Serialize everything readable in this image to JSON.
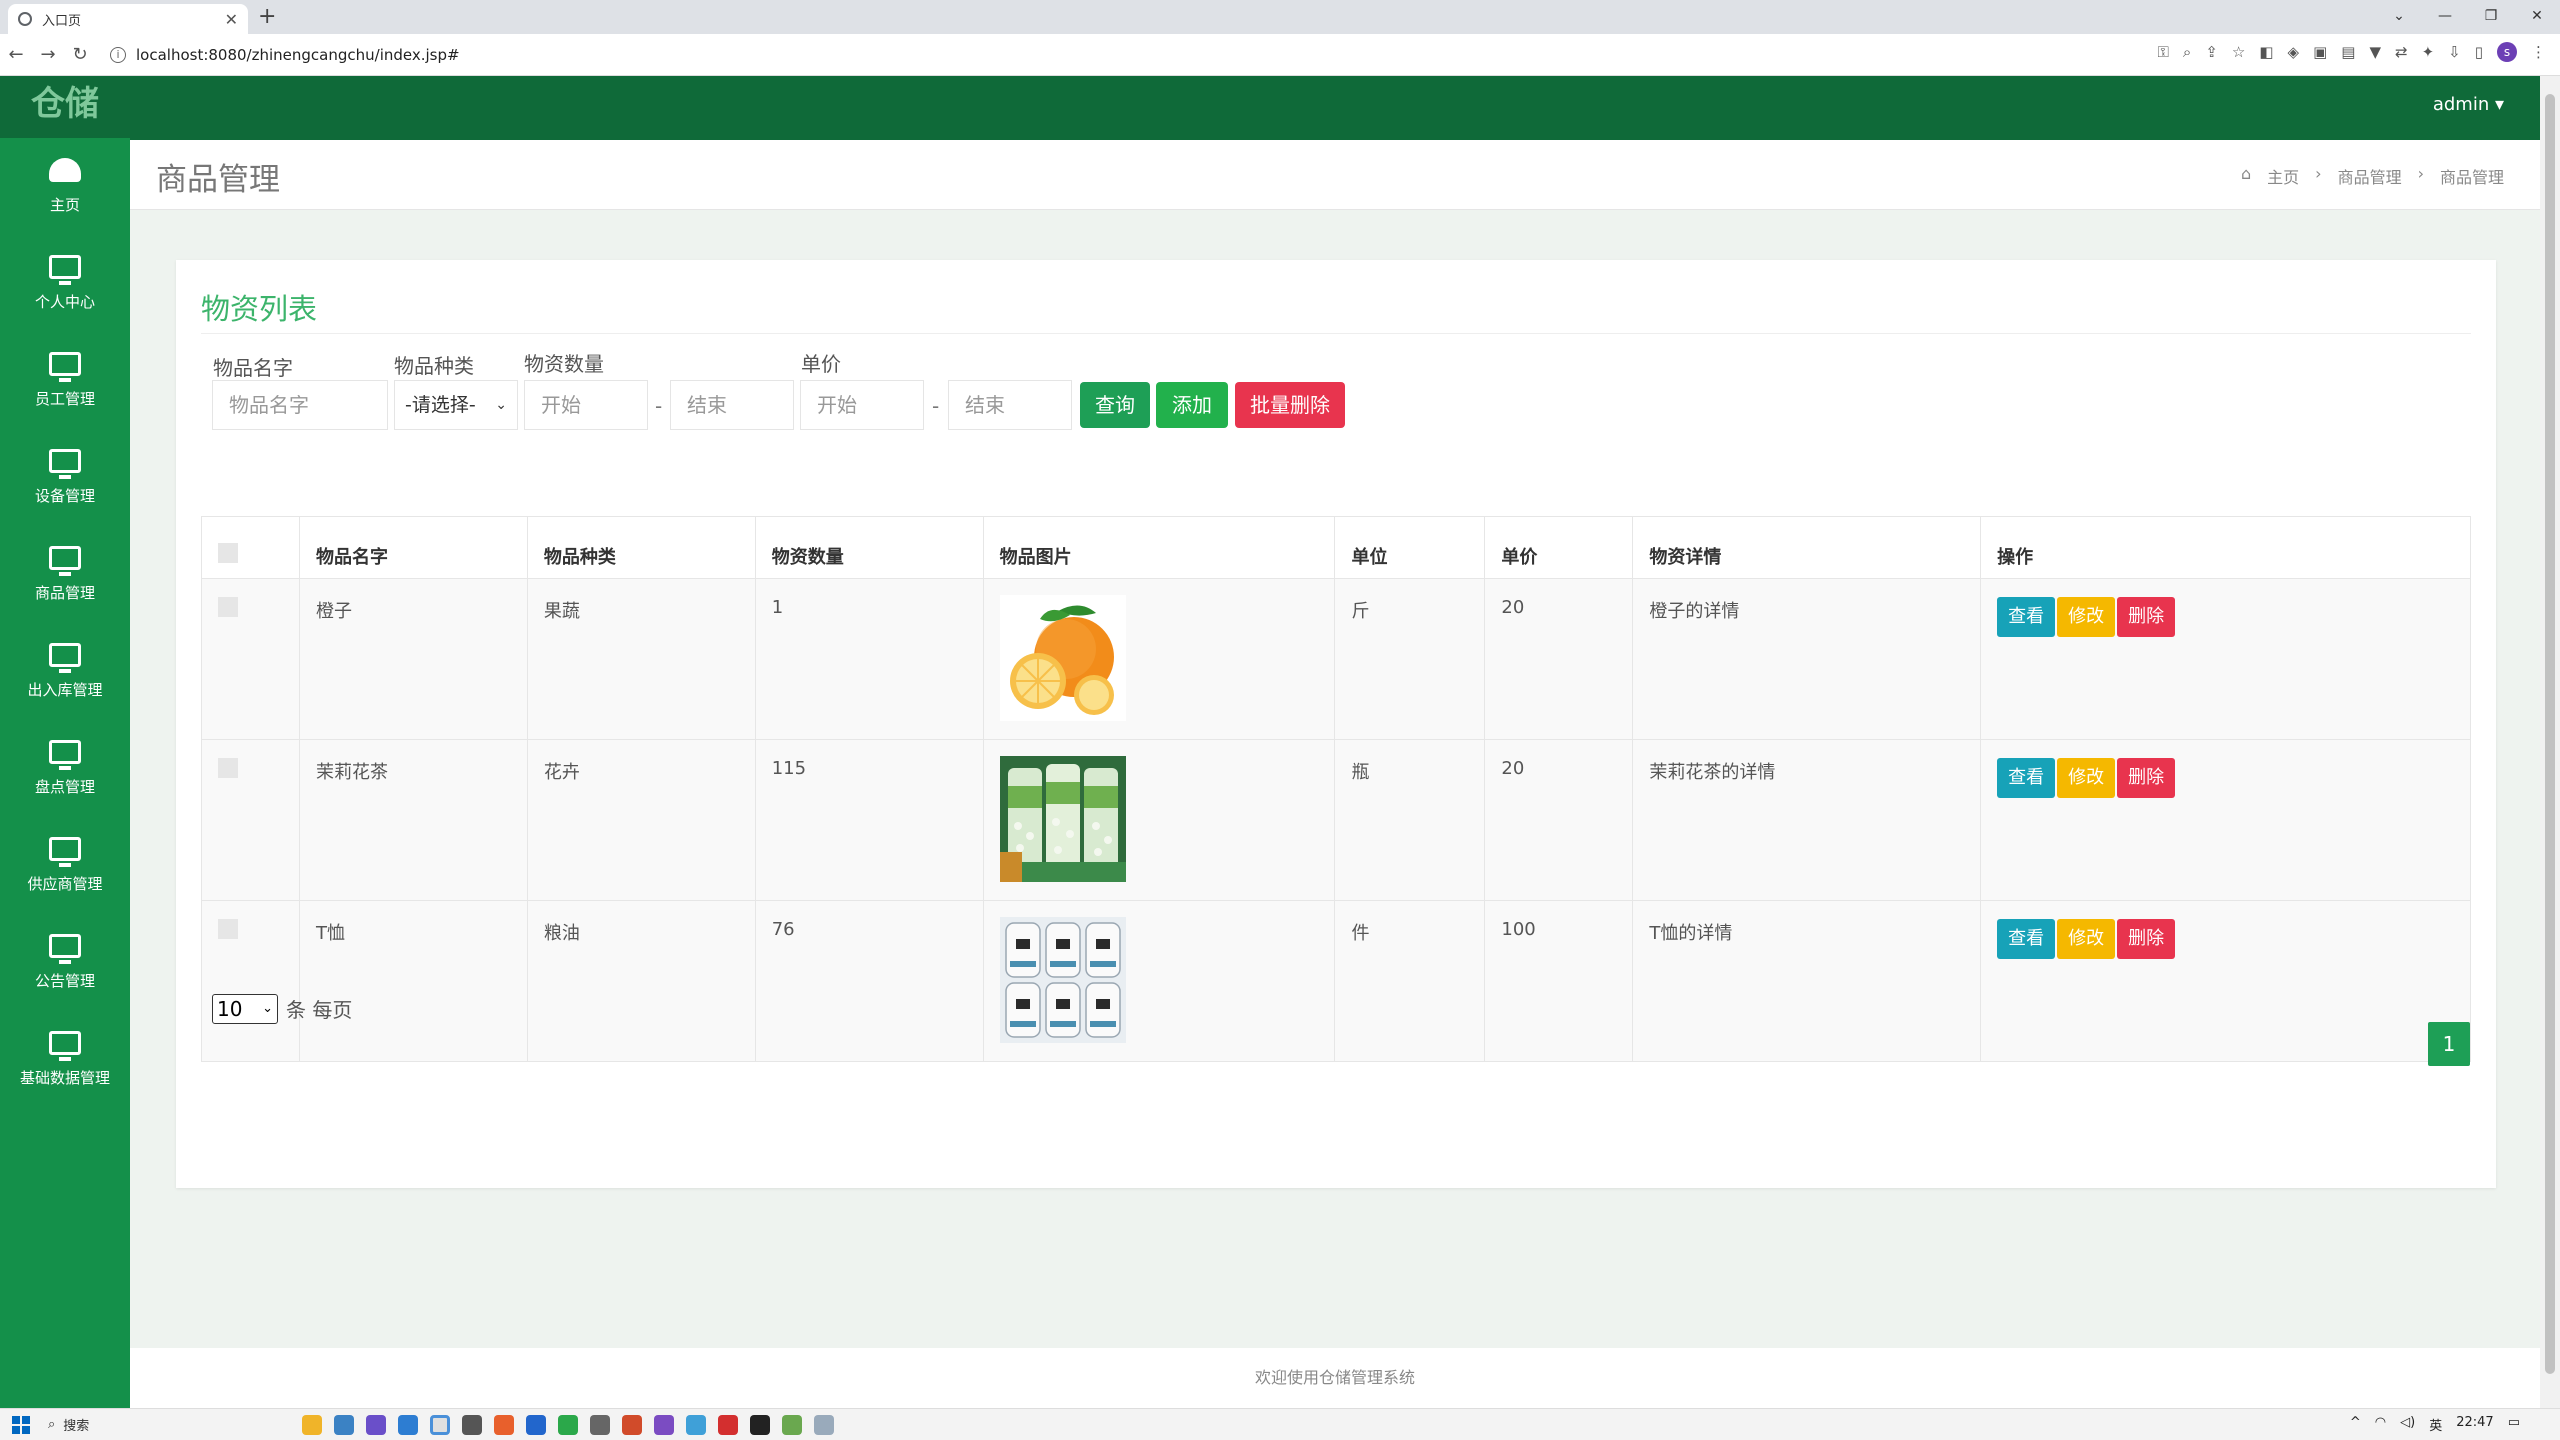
{
  "browser": {
    "tab_title": "入口页",
    "url": "localhost:8080/zhinengcangchu/index.jsp#"
  },
  "app": {
    "logo": "仓储",
    "user": "admin ▾",
    "footer": "欢迎使用仓储管理系统"
  },
  "sidebar": {
    "items": [
      {
        "label": "主页",
        "icon": "dashboard-icon"
      },
      {
        "label": "个人中心",
        "icon": "monitor-icon"
      },
      {
        "label": "员工管理",
        "icon": "monitor-icon"
      },
      {
        "label": "设备管理",
        "icon": "monitor-icon"
      },
      {
        "label": "商品管理",
        "icon": "monitor-icon"
      },
      {
        "label": "出入库管理",
        "icon": "monitor-icon"
      },
      {
        "label": "盘点管理",
        "icon": "monitor-icon"
      },
      {
        "label": "供应商管理",
        "icon": "monitor-icon"
      },
      {
        "label": "公告管理",
        "icon": "monitor-icon"
      },
      {
        "label": "基础数据管理",
        "icon": "monitor-icon"
      }
    ]
  },
  "page": {
    "title": "商品管理",
    "breadcrumb": [
      "主页",
      "商品管理",
      "商品管理"
    ]
  },
  "panel": {
    "title": "物资列表",
    "filters": {
      "name_label": "物品名字",
      "name_placeholder": "物品名字",
      "type_label": "物品种类",
      "type_selected": "-请选择-",
      "qty_label": "物资数量",
      "qty_start": "开始",
      "qty_end": "结束",
      "price_label": "单价",
      "price_start": "开始",
      "price_end": "结束",
      "dash": "-"
    },
    "buttons": {
      "search": "查询",
      "add": "添加",
      "batch_delete": "批量删除"
    },
    "table": {
      "headers": [
        "物品名字",
        "物品种类",
        "物资数量",
        "物品图片",
        "单位",
        "单价",
        "物资详情",
        "操作"
      ],
      "rows": [
        {
          "name": "橙子",
          "type": "果蔬",
          "qty": "1",
          "unit": "斤",
          "price": "20",
          "detail": "橙子的详情",
          "img": "orange"
        },
        {
          "name": "茉莉花茶",
          "type": "花卉",
          "qty": "115",
          "unit": "瓶",
          "price": "20",
          "detail": "茉莉花茶的详情",
          "img": "tea"
        },
        {
          "name": "T恤",
          "type": "粮油",
          "qty": "76",
          "unit": "件",
          "price": "100",
          "detail": "T恤的详情",
          "img": "tshirt"
        }
      ],
      "actions": {
        "view": "查看",
        "edit": "修改",
        "delete": "删除"
      }
    },
    "page_size": "10",
    "per_page_text": "条 每页",
    "current_page": "1"
  },
  "taskbar": {
    "search": "搜索",
    "ime": "英",
    "time": "22:47"
  },
  "colors": {
    "sidebar": "#14904a",
    "topbar": "#0f6a39",
    "search_btn": "#1e9f56",
    "add_btn": "#22b14c",
    "delete_btn": "#e8344e",
    "view_btn": "#17a2b8",
    "edit_btn": "#f5b800"
  }
}
